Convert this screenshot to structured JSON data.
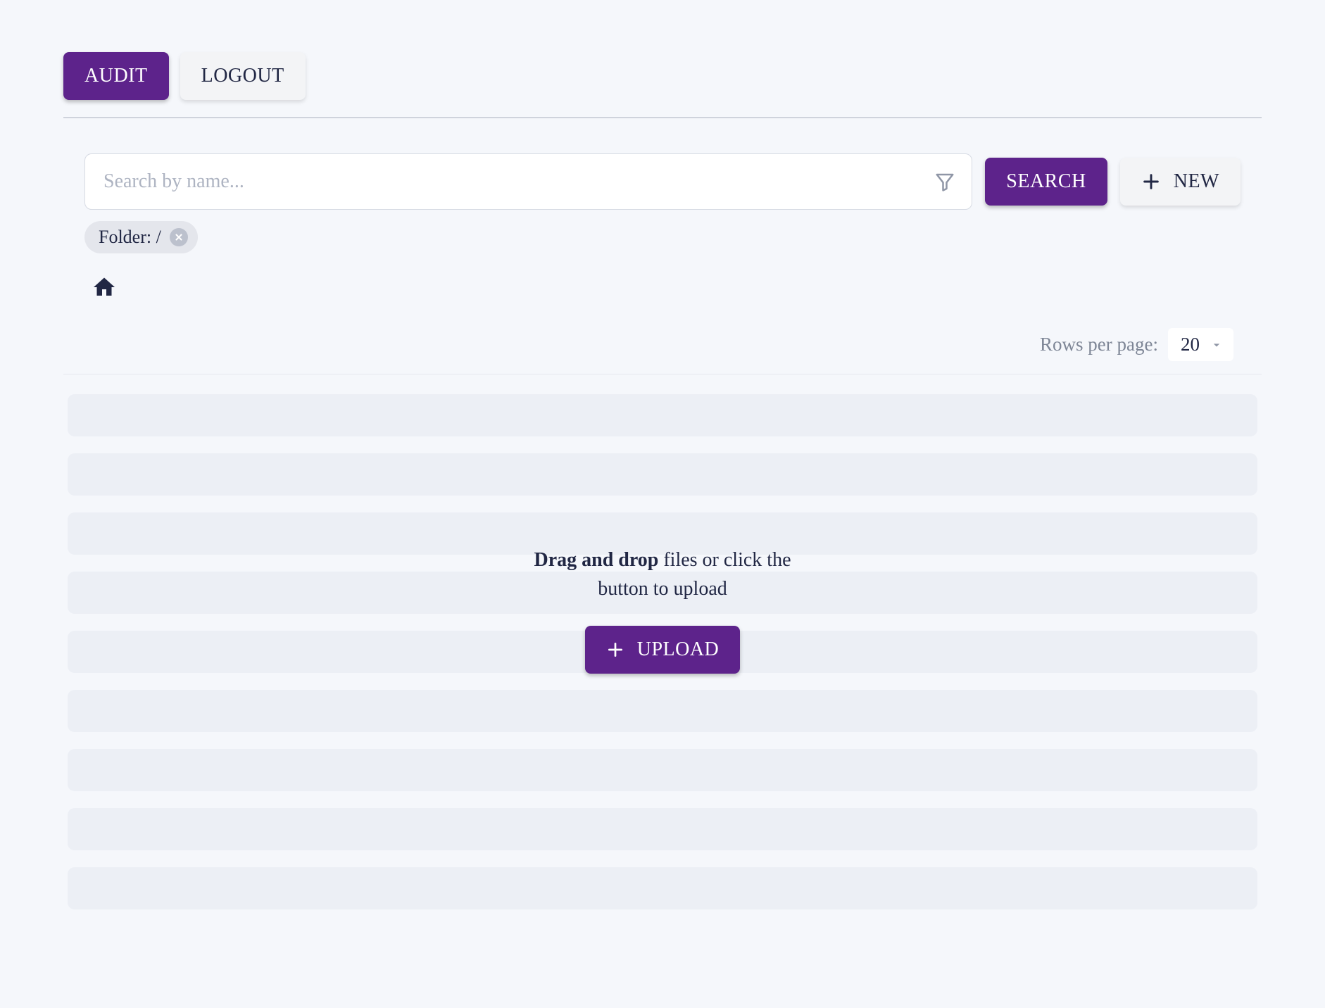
{
  "header": {
    "audit_label": "AUDIT",
    "logout_label": "LOGOUT"
  },
  "search": {
    "placeholder": "Search by name...",
    "value": "",
    "search_button_label": "SEARCH",
    "new_button_label": "NEW"
  },
  "filters": {
    "folder_chip_label": "Folder: /"
  },
  "pagination": {
    "rows_per_page_label": "Rows per page:",
    "rows_per_page_value": "20"
  },
  "dropzone": {
    "bold_text": "Drag and drop",
    "rest_text": " files or click the button to upload",
    "upload_label": "UPLOAD"
  },
  "colors": {
    "accent": "#5d238b"
  }
}
